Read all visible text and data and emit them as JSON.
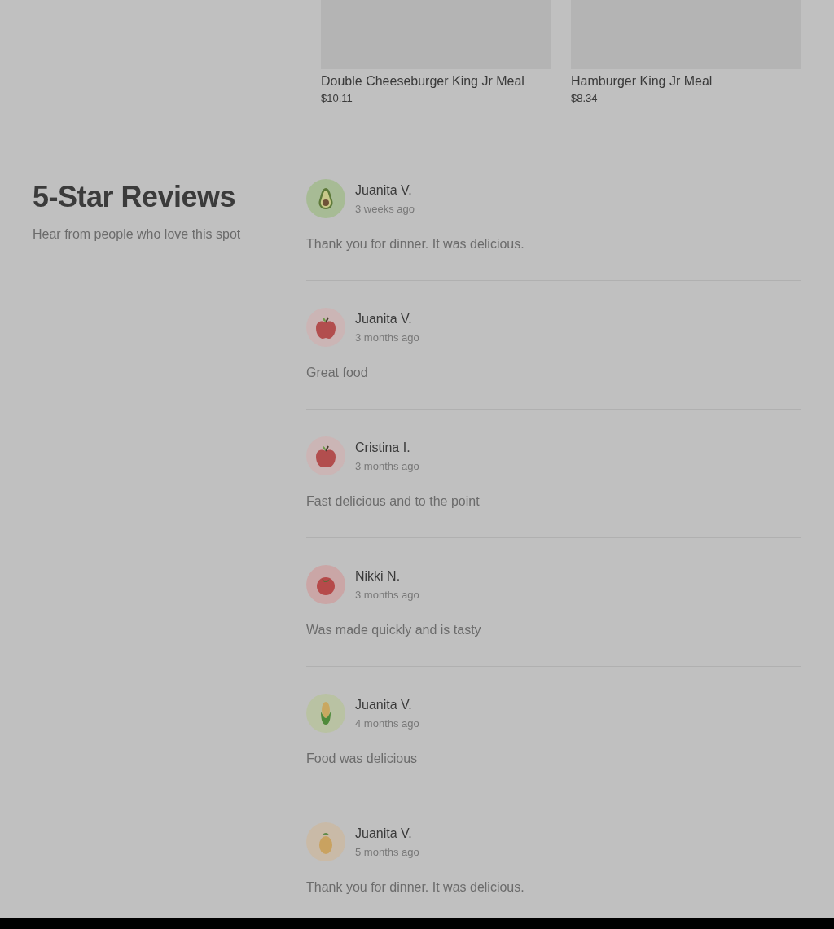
{
  "menu_items": [
    {
      "name": "Double Cheeseburger King Jr Meal",
      "price": "$10.11"
    },
    {
      "name": "Hamburger King Jr Meal",
      "price": "$8.34"
    }
  ],
  "reviews_section": {
    "title": "5-Star Reviews",
    "subtitle": "Hear from people who love this spot"
  },
  "reviews": [
    {
      "avatar": {
        "kind": "avocado"
      },
      "author": "Juanita V.",
      "time": "3 weeks ago",
      "text": "Thank you for dinner. It was delicious."
    },
    {
      "avatar": {
        "kind": "apple"
      },
      "author": "Juanita V.",
      "time": "3 months ago",
      "text": "Great food"
    },
    {
      "avatar": {
        "kind": "apple"
      },
      "author": "Cristina I.",
      "time": "3 months ago",
      "text": "Fast delicious and to the point"
    },
    {
      "avatar": {
        "kind": "tomato"
      },
      "author": "Nikki N.",
      "time": "3 months ago",
      "text": "Was made quickly and is tasty"
    },
    {
      "avatar": {
        "kind": "corn"
      },
      "author": "Juanita V.",
      "time": "4 months ago",
      "text": "Food was delicious"
    },
    {
      "avatar": {
        "kind": "pineapple"
      },
      "author": "Juanita V.",
      "time": "5 months ago",
      "text": "Thank you for dinner. It was delicious."
    }
  ]
}
